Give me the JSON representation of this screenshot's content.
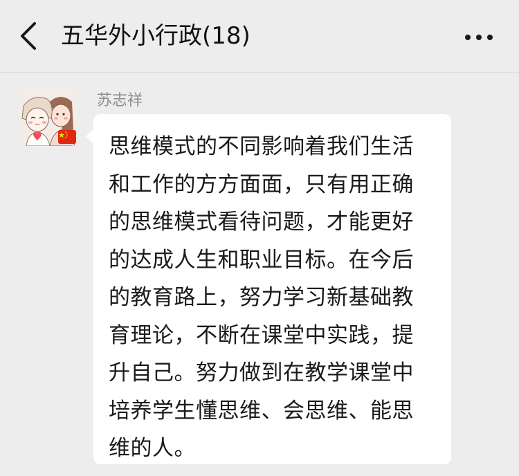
{
  "header": {
    "title": "五华外小行政(18)",
    "back_icon": "chevron-left-icon",
    "more_icon": "more-dots-icon"
  },
  "message": {
    "sender": "苏志祥",
    "avatar_icon": "cartoon-avatar",
    "badge_icon": "china-flag-icon",
    "lines": [
      "思维模式的不同影响着我们生活",
      "和工作的方方面面，只有用正确",
      "的思维模式看待问题，才能更好",
      "的达成人生和职业目标。在今后",
      "的教育路上，努力学习新基础教",
      "育理论，不断在课堂中实践，提",
      "升自己。努力做到在教学课堂中",
      "培养学生懂思维、会思维、能思",
      "维的人。"
    ]
  },
  "colors": {
    "background": "#ededed",
    "bubble": "#ffffff",
    "text": "#1a1a1a",
    "sender_text": "#8d8d8d"
  }
}
